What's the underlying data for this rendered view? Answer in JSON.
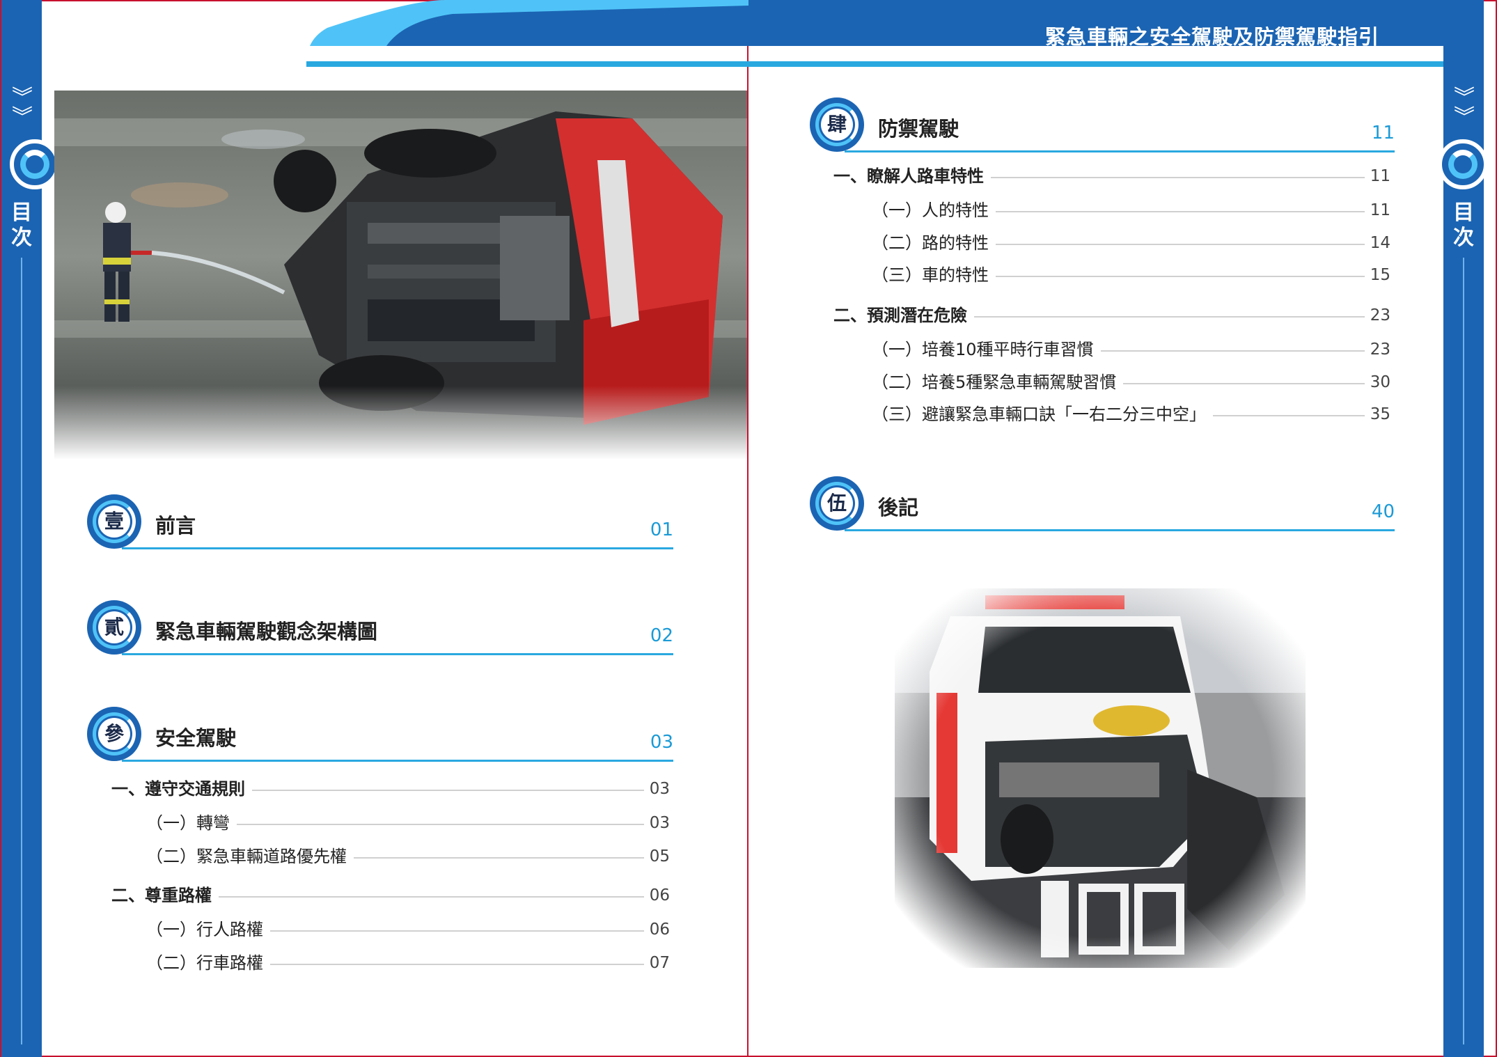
{
  "header": {
    "title": "緊急車輛之安全駕駛及防禦駕駛指引"
  },
  "sidebar": {
    "left_title_line1": "目",
    "left_title_line2": "次",
    "right_title_line1": "目",
    "right_title_line2": "次"
  },
  "colors": {
    "brand_blue": "#1b64b3",
    "accent_cyan": "#29a8e0",
    "frame_red": "#c8102e"
  },
  "left_page": {
    "sections": [
      {
        "badge": "壹",
        "title": "前言",
        "page": "01"
      },
      {
        "badge": "貳",
        "title": "緊急車輛駕駛觀念架構圖",
        "page": "02"
      },
      {
        "badge": "參",
        "title": "安全駕駛",
        "page": "03"
      }
    ],
    "entries": [
      {
        "label": "一、遵守交通規則",
        "page": "03",
        "level": 1
      },
      {
        "label": "（一）轉彎",
        "page": "03",
        "level": 2
      },
      {
        "label": "（二）緊急車輛道路優先權",
        "page": "05",
        "level": 2
      },
      {
        "label": "二、尊重路權",
        "page": "06",
        "level": 1
      },
      {
        "label": "（一）行人路權",
        "page": "06",
        "level": 2
      },
      {
        "label": "（二）行車路權",
        "page": "07",
        "level": 2
      }
    ]
  },
  "right_page": {
    "sections": [
      {
        "badge": "肆",
        "title": "防禦駕駛",
        "page": "11"
      },
      {
        "badge": "伍",
        "title": "後記",
        "page": "40"
      }
    ],
    "entries": [
      {
        "label": "一、瞭解人路車特性",
        "page": "11",
        "level": 1
      },
      {
        "label": "（一）人的特性",
        "page": "11",
        "level": 2
      },
      {
        "label": "（二）路的特性",
        "page": "14",
        "level": 2
      },
      {
        "label": "（三）車的特性",
        "page": "15",
        "level": 2
      },
      {
        "label": "二、預測潛在危險",
        "page": "23",
        "level": 1
      },
      {
        "label": "（一）培養10種平時行車習慣",
        "page": "23",
        "level": 2
      },
      {
        "label": "（二）培養5種緊急車輛駕駛習慣",
        "page": "30",
        "level": 2
      },
      {
        "label": "（三）避讓緊急車輛口訣「一右二分三中空」",
        "page": "35",
        "level": 2
      }
    ]
  }
}
